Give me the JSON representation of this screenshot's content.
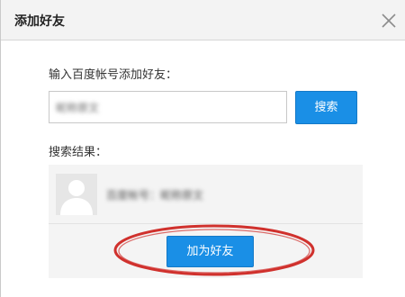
{
  "dialog": {
    "title": "添加好友",
    "close_icon": "close-icon"
  },
  "add_friend": {
    "label": "输入百度帐号添加好友：",
    "input_value": "昵称原文",
    "search_button": "搜索"
  },
  "results": {
    "label": "搜索结果：",
    "items": [
      {
        "avatar_icon": "default-avatar-icon",
        "name": "百度帐号：昵称原文"
      }
    ],
    "add_button": "加为好友"
  },
  "annotation": {
    "highlight_color": "#d0312d"
  }
}
